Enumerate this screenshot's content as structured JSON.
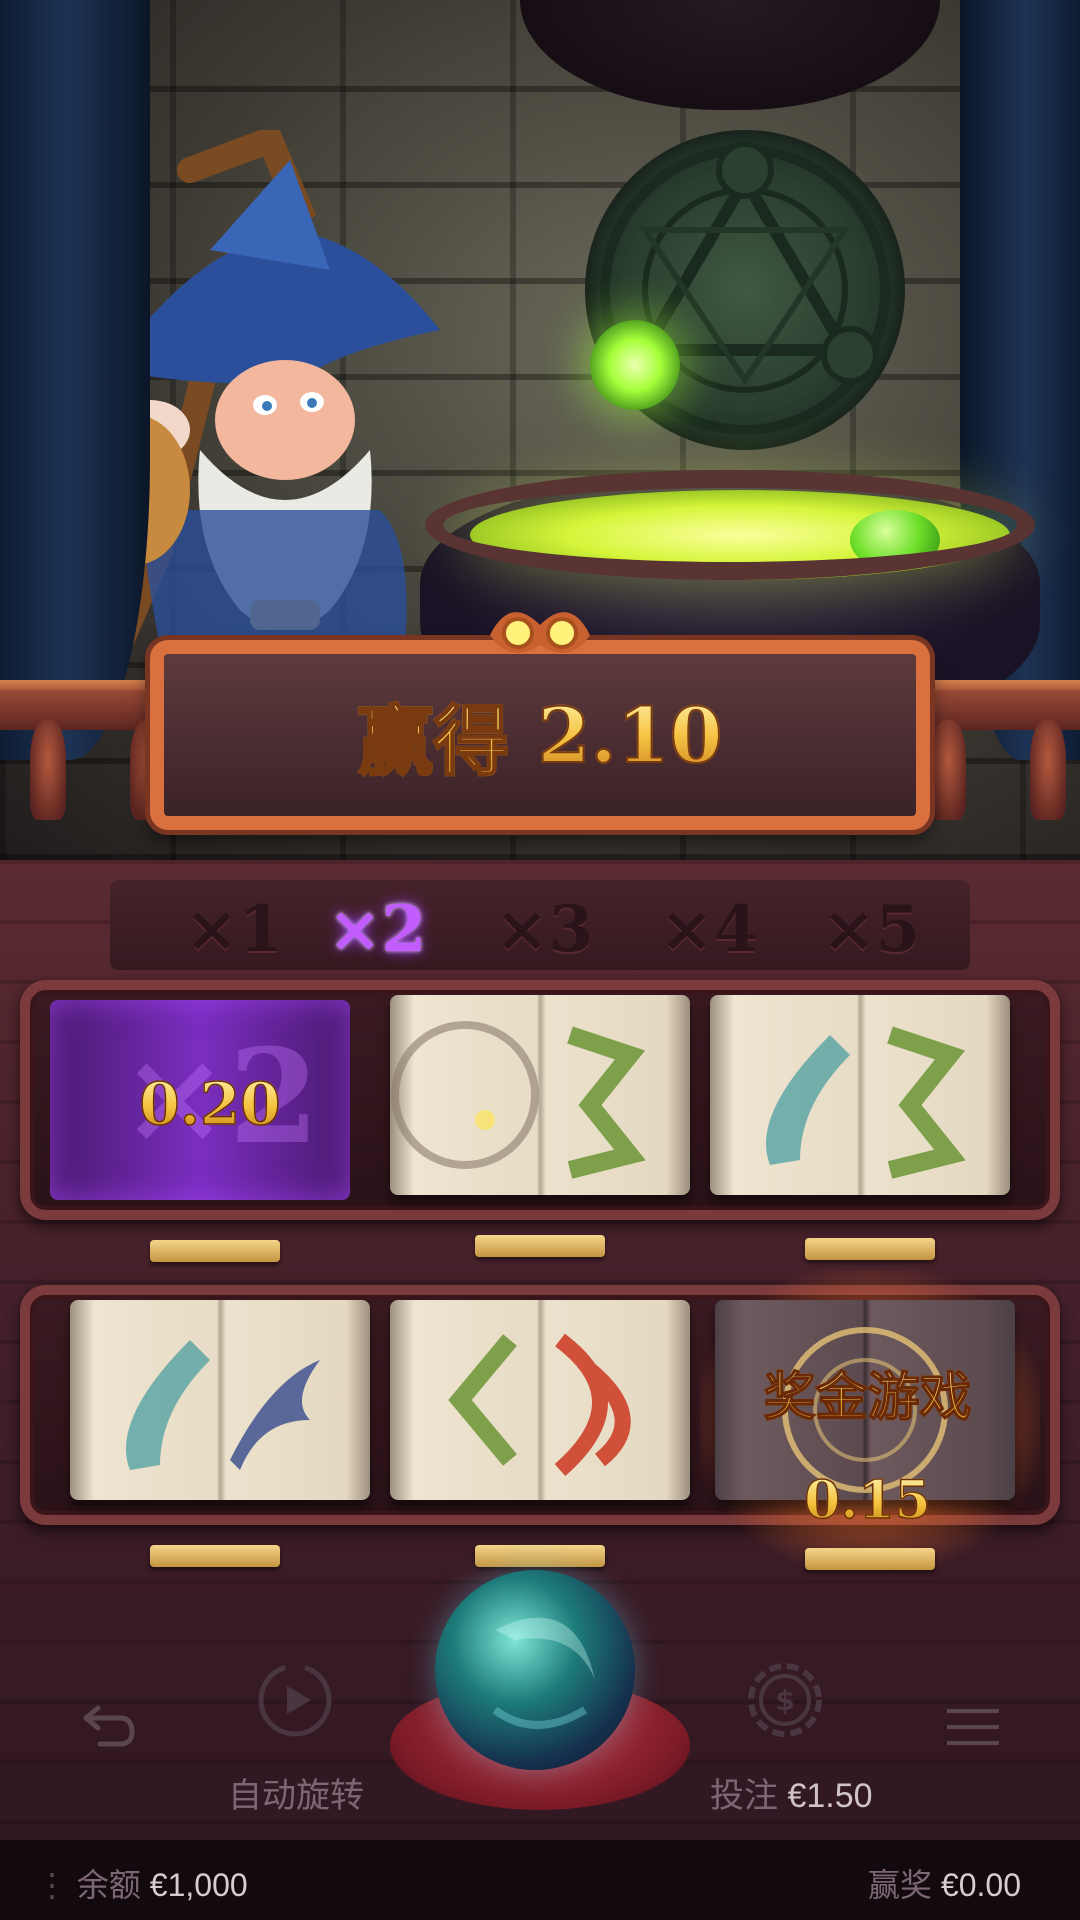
{
  "win": {
    "label": "赢得",
    "amount": "2.10"
  },
  "multipliers": {
    "items": [
      "×1",
      "×2",
      "×3",
      "×4",
      "×5"
    ],
    "active_index": 1
  },
  "grid": {
    "row1": {
      "cell1": {
        "type": "multiplier",
        "value": "0.20",
        "ghost": "×2"
      },
      "cell2": {
        "type": "book"
      },
      "cell3": {
        "type": "book"
      }
    },
    "row2": {
      "cell1": {
        "type": "book"
      },
      "cell2": {
        "type": "book"
      },
      "cell3": {
        "type": "bonus",
        "label": "奖金游戏",
        "value": "0.15"
      }
    }
  },
  "controls": {
    "back_icon": "back-arrow-icon",
    "autospin_icon": "autospin-icon",
    "autospin_label": "自动旋转",
    "spin_icon": "crystal-ball-icon",
    "bet_icon": "coin-icon",
    "bet_label": "投注",
    "bet_value": "€1.50",
    "menu_icon": "menu-icon"
  },
  "footer": {
    "balance_label": "余额",
    "balance_value": "€1,000",
    "win_label": "赢奖",
    "win_value": "€0.00"
  },
  "colors": {
    "accent_purple": "#c35cff",
    "gold": "#f4c23c",
    "frame_orange": "#d9703d"
  }
}
